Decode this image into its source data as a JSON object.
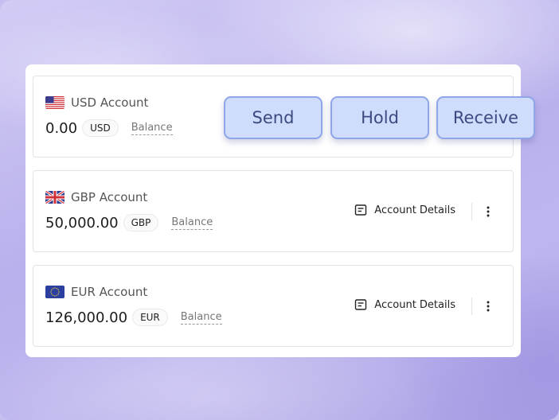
{
  "accounts": [
    {
      "name": "USD Account",
      "flag_icon": "us-flag-icon",
      "amount": "0.00",
      "currency": "USD",
      "balance_label": "Balance"
    },
    {
      "name": "GBP Account",
      "flag_icon": "uk-flag-icon",
      "amount": "50,000.00",
      "currency": "GBP",
      "balance_label": "Balance",
      "details_label": "Account Details",
      "details_icon": "document-icon",
      "more_icon": "more-vertical-icon"
    },
    {
      "name": "EUR Account",
      "flag_icon": "eu-flag-icon",
      "amount": "126,000.00",
      "currency": "EUR",
      "balance_label": "Balance",
      "details_label": "Account Details",
      "details_icon": "document-icon",
      "more_icon": "more-vertical-icon"
    }
  ],
  "actions": {
    "send_label": "Send",
    "hold_label": "Hold",
    "receive_label": "Receive"
  },
  "colors": {
    "background": "#c5bff0",
    "action_fill": "#cfdcfb",
    "action_border": "#8fa6e8",
    "action_text": "#3c4a82"
  }
}
